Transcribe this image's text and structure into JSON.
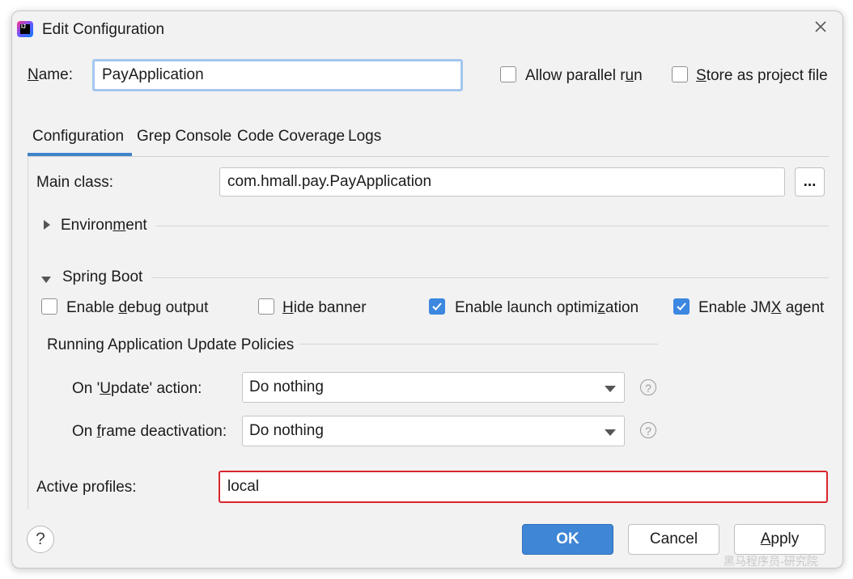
{
  "window": {
    "title": "Edit Configuration"
  },
  "name_row": {
    "label_underlined": "N",
    "label_rest": "ame:",
    "value": "PayApplication",
    "allow_parallel_pre": "Allow parallel r",
    "allow_parallel_ul": "u",
    "allow_parallel_post": "n",
    "store_ul": "S",
    "store_rest": "tore as project file"
  },
  "tabs": [
    "Configuration",
    "Grep Console",
    "Code Coverage",
    "Logs"
  ],
  "main_class": {
    "label": "Main class:",
    "value": "com.hmall.pay.PayApplication",
    "browse_label": "..."
  },
  "environment": {
    "pre": "Environ",
    "ul": "m",
    "post": "ent"
  },
  "spring_boot": {
    "title": "Spring Boot",
    "debug": {
      "pre": "Enable ",
      "ul": "d",
      "post": "ebug output",
      "checked": false
    },
    "hide_banner": {
      "ul": "H",
      "post": "ide banner",
      "checked": false
    },
    "launch_opt": {
      "pre": "Enable launch optimi",
      "ul": "z",
      "post": "ation",
      "checked": true
    },
    "jmx": {
      "pre": "Enable JM",
      "ul": "X",
      "post": " agent",
      "checked": true
    }
  },
  "policies": {
    "title": "Running Application Update Policies",
    "update": {
      "pre": "On '",
      "ul": "U",
      "post": "pdate' action:",
      "value": "Do nothing"
    },
    "frame": {
      "pre": "On ",
      "ul": "f",
      "post": "rame deactivation:",
      "value": "Do nothing"
    },
    "help": "?"
  },
  "active_profiles": {
    "label": "Active profiles:",
    "value": "local",
    "highlight_color": "#d9262c"
  },
  "buttons": {
    "help": "?",
    "ok": "OK",
    "cancel": "Cancel",
    "apply_ul": "A",
    "apply_rest": "pply"
  },
  "watermark": "黑马程序员-研究院",
  "colors": {
    "accent": "#4083c9",
    "ok_button": "#3f86d6",
    "checkbox": "#3c87e0"
  }
}
